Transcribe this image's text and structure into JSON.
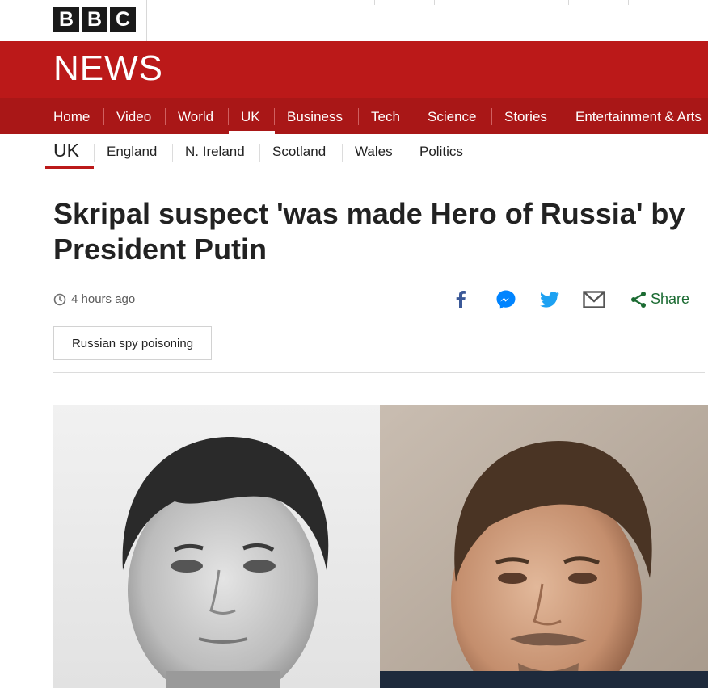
{
  "brand": {
    "letters": [
      "B",
      "B",
      "C"
    ],
    "section": "NEWS"
  },
  "colors": {
    "brand_red": "#bb1919",
    "nav_red": "#a91717",
    "share_green": "#1b6b32",
    "facebook_blue": "#3b5998",
    "messenger_blue": "#0084ff",
    "twitter_blue": "#1da1f2"
  },
  "main_nav": {
    "items": [
      "Home",
      "Video",
      "World",
      "UK",
      "Business",
      "Tech",
      "Science",
      "Stories",
      "Entertainment & Arts"
    ],
    "active": "UK"
  },
  "sub_nav": {
    "current": "UK",
    "items": [
      "England",
      "N. Ireland",
      "Scotland",
      "Wales",
      "Politics"
    ]
  },
  "article": {
    "headline": "Skripal suspect 'was made Hero of Russia' by President Putin",
    "timestamp": "4 hours ago",
    "tag": "Russian spy poisoning"
  },
  "share": {
    "label": "Share",
    "icons": [
      "facebook-icon",
      "messenger-icon",
      "twitter-icon",
      "email-icon",
      "share-icon"
    ]
  }
}
